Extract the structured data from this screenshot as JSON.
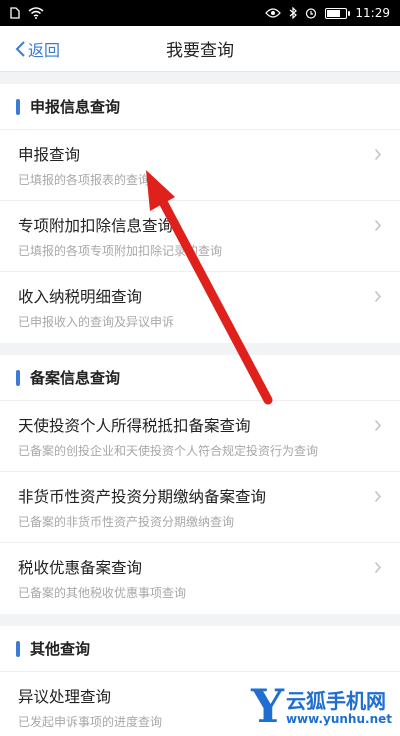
{
  "status_bar": {
    "time": "11:29"
  },
  "nav": {
    "back_label": "返回",
    "title": "我要查询"
  },
  "sections": [
    {
      "title": "申报信息查询",
      "items": [
        {
          "title": "申报查询",
          "subtitle": "已填报的各项报表的查询"
        },
        {
          "title": "专项附加扣除信息查询",
          "subtitle": "已填报的各项专项附加扣除记录的查询"
        },
        {
          "title": "收入纳税明细查询",
          "subtitle": "已申报收入的查询及异议申诉"
        }
      ]
    },
    {
      "title": "备案信息查询",
      "items": [
        {
          "title": "天使投资个人所得税抵扣备案查询",
          "subtitle": "已备案的创投企业和天使投资个人符合规定投资行为查询"
        },
        {
          "title": "非货币性资产投资分期缴纳备案查询",
          "subtitle": "已备案的非货币性资产投资分期缴纳查询"
        },
        {
          "title": "税收优惠备案查询",
          "subtitle": "已备案的其他税收优惠事项查询"
        }
      ]
    },
    {
      "title": "其他查询",
      "items": [
        {
          "title": "异议处理查询",
          "subtitle": "已发起申诉事项的进度查询"
        }
      ]
    }
  ],
  "watermark": {
    "letter": "Y",
    "name": "云狐手机网",
    "url": "www.yunhu.net"
  },
  "colors": {
    "accent": "#3a7bd5",
    "annotation_arrow": "#e0211b"
  }
}
